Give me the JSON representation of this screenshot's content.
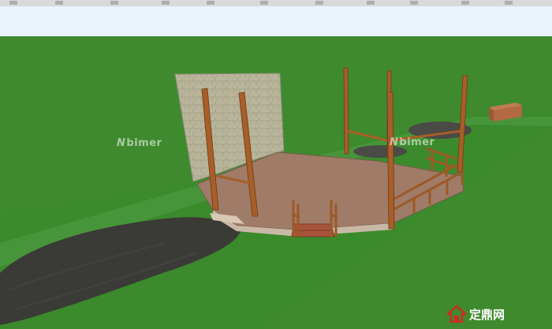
{
  "scene": {
    "sky_color": "#e8f3fb",
    "lawn_color": "#3f8a2e",
    "path_color": "#3a3a36",
    "deck_color": "#a07b68",
    "post_color": "#9c5a26",
    "wall_color": "#b8b59a",
    "elements": [
      "stone-wall",
      "wooden-pergola",
      "timber-deck",
      "deck-railing",
      "deck-steps",
      "stone-path",
      "planter-box",
      "pond"
    ]
  },
  "watermarks": [
    {
      "prefix": "N",
      "text": "bimer"
    },
    {
      "prefix": "N",
      "text": "bimer"
    }
  ],
  "logo": {
    "icon": "house-logo-icon",
    "text": "定鼎网",
    "domain": ""
  }
}
